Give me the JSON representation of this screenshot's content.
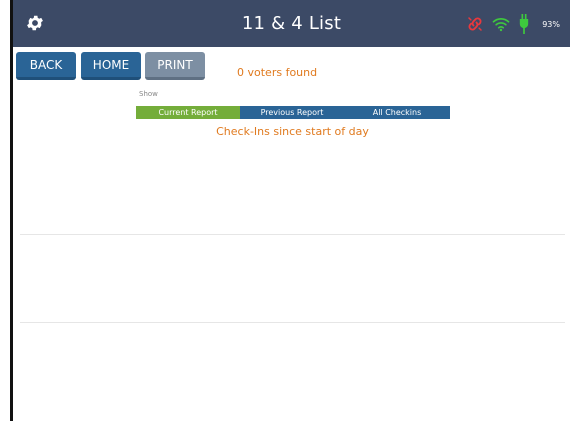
{
  "header": {
    "title": "11 & 4 List",
    "settings_icon": "gear-icon",
    "status": {
      "disconnected_icon": "broken-link-icon",
      "wifi_icon": "wifi-icon",
      "power_icon": "plug-icon",
      "battery_percent": "93%"
    }
  },
  "toolbar": {
    "back_label": "BACK",
    "home_label": "HOME",
    "print_label": "PRINT"
  },
  "results": {
    "voters_found": "0 voters found"
  },
  "report_filter": {
    "show_label": "Show",
    "options": [
      "Current Report",
      "Previous Report",
      "All Checkins"
    ],
    "selected": "Current Report"
  },
  "report": {
    "subtitle": "Check-Ins since start of day"
  },
  "colors": {
    "header_bg": "#3c4a66",
    "button_blue": "#2a6496",
    "button_gray": "#7d8fa3",
    "selected_green": "#74ad3a",
    "accent_orange": "#e07a1f",
    "status_red": "#e8383d",
    "status_green": "#3ec93e"
  }
}
